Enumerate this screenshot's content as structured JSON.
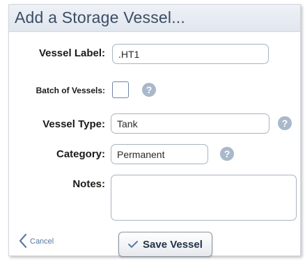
{
  "dialog": {
    "title": "Add a Storage Vessel..."
  },
  "form": {
    "vessel_label": {
      "label": "Vessel Label:",
      "value": ".HT1"
    },
    "batch": {
      "label": "Batch of Vessels:",
      "checked": false
    },
    "vessel_type": {
      "label": "Vessel Type:",
      "value": "Tank"
    },
    "category": {
      "label": "Category:",
      "value": "Permanent"
    },
    "notes": {
      "label": "Notes:",
      "value": ""
    }
  },
  "help": {
    "glyph": "?"
  },
  "actions": {
    "cancel_label": "Cancel",
    "save_label": "Save Vessel"
  },
  "icons": {
    "help": "question-circle-icon",
    "cancel": "chevron-left-icon",
    "save": "checkmark-icon"
  },
  "colors": {
    "header_bg": "#e1e6ee",
    "title": "#3a4d66",
    "help_icon": "#a9b8cb",
    "link": "#5577a0",
    "accent": "#5b7aa6"
  }
}
